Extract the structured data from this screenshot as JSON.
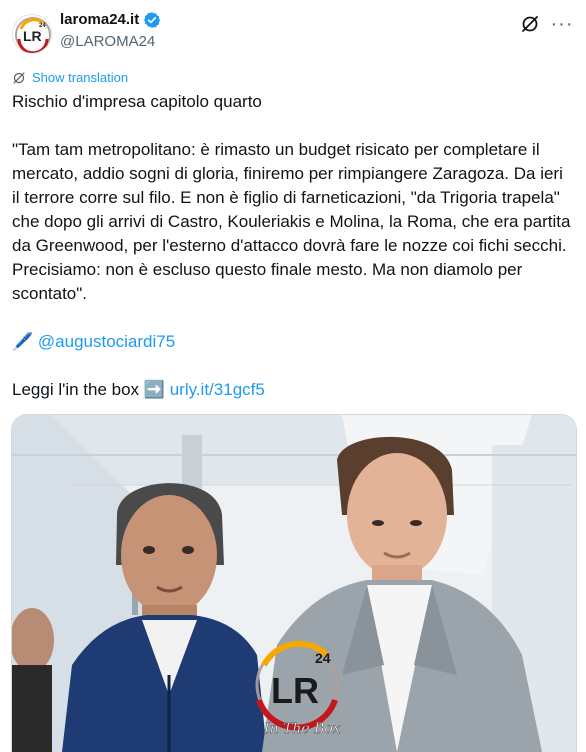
{
  "header": {
    "display_name": "laroma24.it",
    "handle": "@LAROMA24",
    "avatar_text": "LR",
    "avatar_sup": "24",
    "more_label": "···"
  },
  "translate": {
    "label": "Show translation"
  },
  "tweet": {
    "line1": "Rischio d'impresa capitolo quarto",
    "para": "\"Tam tam metropolitano: è rimasto un budget risicato per completare il mercato, addio sogni di gloria, finiremo per rimpiangere Zaragoza. Da ieri il terrore corre sul filo. E non è figlio di farneticazioni, \"da Trigoria trapela\" che dopo gli arrivi di Castro, Kouleriakis e Molina, la Roma, che era partita da Greenwood, per l'esterno d'attacco dovrà fare le nozze coi fichi secchi. Precisiamo: non è escluso questo finale mesto. Ma non diamolo per scontato\".",
    "pen_emoji": "🖊️",
    "mention": "@augustociardi75",
    "leggi": "Leggi l'in the box",
    "arrow_emoji": "➡️",
    "link": "urly.it/31gcf5"
  },
  "media": {
    "watermark_text": "LR",
    "watermark_sup": "24",
    "watermark_script": "In The Box"
  },
  "colors": {
    "accent": "#1d9bf0",
    "text": "#0f1419",
    "muted": "#536471"
  }
}
